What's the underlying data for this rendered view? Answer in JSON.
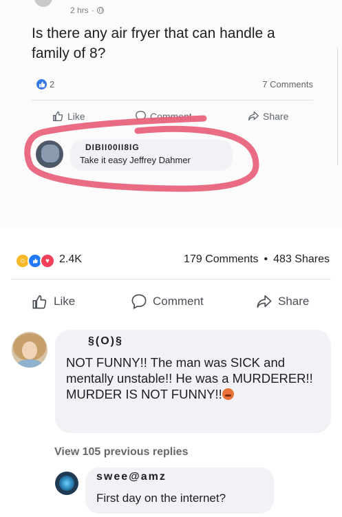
{
  "top_post": {
    "timestamp": "2 hrs",
    "question": "Is there any air fryer that can handle a family of 8?",
    "reaction_count": "2",
    "comments_count": "7 Comments",
    "actions": {
      "like": "Like",
      "comment": "Comment",
      "share": "Share"
    },
    "comment": {
      "author": "DIBII00II8IG",
      "text": "Take it easy Jeffrey Dahmer"
    },
    "highlight_color": "#e8607a"
  },
  "post": {
    "reaction_count": "2.4K",
    "comments": "179 Comments",
    "separator": "•",
    "shares": "483 Shares",
    "reactions": [
      "haha-icon",
      "like-icon",
      "love-icon"
    ],
    "actions": {
      "like": "Like",
      "comment": "Comment",
      "share": "Share"
    },
    "comment": {
      "author": "§(O)§",
      "text": "NOT FUNNY!! The man was SICK and mentally unstable!! He was a MURDERER!! MURDER IS NOT FUNNY!!"
    },
    "view_replies": "View 105 previous replies",
    "reply": {
      "author": "swee@amz",
      "text": "First day on the internet?"
    }
  },
  "colors": {
    "like_blue": "#3578e5",
    "bubble": "#f0f2f5",
    "muted": "#65676b"
  }
}
